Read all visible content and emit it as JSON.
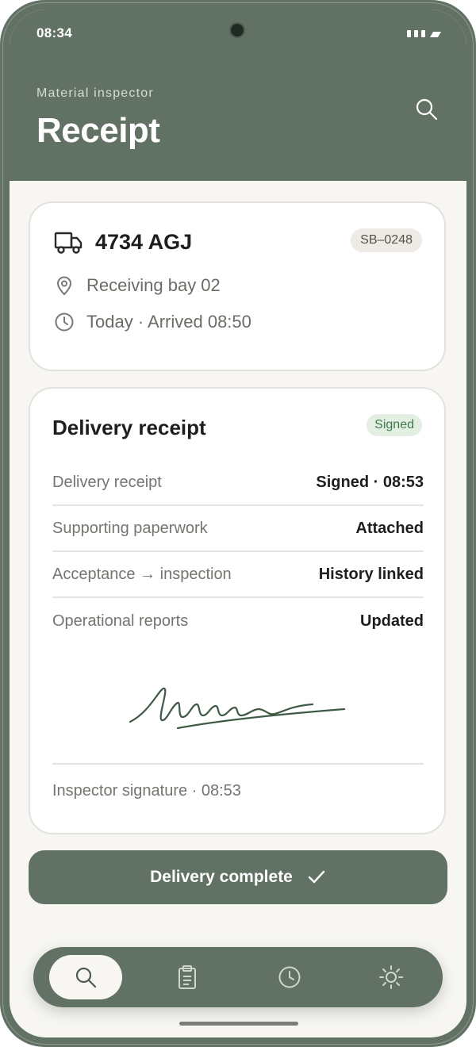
{
  "status_bar": {
    "time": "08:34"
  },
  "header": {
    "subtitle": "Material inspector",
    "title": "Receipt",
    "search_icon": "search-icon"
  },
  "vehicle": {
    "plate": "4734 AGJ",
    "booking_ref": "SB–0248",
    "location": "Receiving bay 02",
    "arrival": "Today · Arrived 08:50",
    "icons": [
      "truck-icon",
      "location-pin-icon",
      "clock-icon"
    ]
  },
  "receipt": {
    "title": "Delivery receipt",
    "status_badge": "Signed",
    "rows": [
      {
        "label": "Delivery receipt",
        "value": "Signed · 08:53"
      },
      {
        "label": "Supporting paperwork",
        "value": "Attached"
      },
      {
        "label": "Acceptance → inspection",
        "value": "History linked"
      },
      {
        "label": "Operational reports",
        "value": "Updated"
      }
    ],
    "signature_caption": "Inspector signature · 08:53"
  },
  "action": {
    "complete_label": "Delivery complete",
    "icon": "check-icon"
  },
  "tabs": [
    {
      "name": "search",
      "icon": "search-icon",
      "active": true
    },
    {
      "name": "clipboard",
      "icon": "clipboard-icon",
      "active": false
    },
    {
      "name": "history",
      "icon": "clock-icon",
      "active": false
    },
    {
      "name": "settings",
      "icon": "sun-icon",
      "active": false
    }
  ],
  "colors": {
    "brand": "#617164",
    "background": "#f7f6f3",
    "signed_badge_bg": "#e3efe3",
    "signed_badge_text": "#3c7a4a"
  }
}
